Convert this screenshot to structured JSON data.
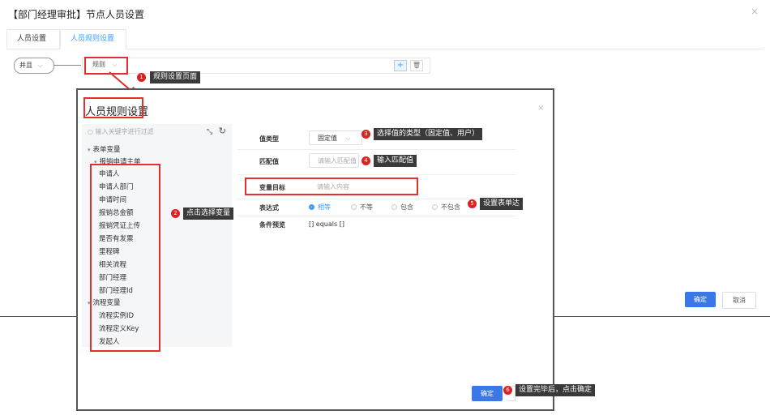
{
  "outer": {
    "title": "【部门经理审批】节点人员设置",
    "close": "×",
    "tabs": [
      {
        "label": "人员设置"
      },
      {
        "label": "人员规则设置"
      }
    ],
    "and_select": "并且",
    "rule_select": "规则",
    "add_button": "+",
    "delete_button": "🗑",
    "ok_button": "确定",
    "cancel_button": "取消"
  },
  "inner": {
    "title": "人员规则设置",
    "close": "×",
    "search_placeholder": "输入关键字进行过滤",
    "tree": {
      "form_vars": "表单变量",
      "main_form": "报销申请主单",
      "fields": [
        "申请人",
        "申请人部门",
        "申请时间",
        "报销总金额",
        "报销凭证上传",
        "是否有发票",
        "里程碑",
        "相关流程",
        "部门经理",
        "部门经理Id"
      ],
      "flow_vars": "流程变量",
      "flow_fields": [
        "流程实例ID",
        "流程定义Key",
        "发起人"
      ]
    },
    "form": {
      "value_type_label": "值类型",
      "value_type_value": "固定值",
      "match_label": "匹配值",
      "match_placeholder": "请输入匹配值",
      "target_label": "变量目标",
      "target_placeholder": "请输入内容",
      "expr_label": "表达式",
      "expr_options": [
        "相等",
        "不等",
        "包含",
        "不包含"
      ],
      "expr_selected": "相等",
      "preview_label": "条件预览",
      "preview_value": "[] equals []"
    },
    "ok_button": "确定"
  },
  "callouts": [
    {
      "num": "1",
      "text": "规则设置页面"
    },
    {
      "num": "2",
      "text": "点击选择变量"
    },
    {
      "num": "3",
      "text": "选择值的类型（固定值、用户）"
    },
    {
      "num": "4",
      "text": "输入匹配值"
    },
    {
      "num": "5",
      "text": "设置表单达"
    },
    {
      "num": "6",
      "text": "设置完毕后，点击确定"
    }
  ],
  "colors": {
    "accent": "#409eff",
    "annotation": "#e03030",
    "primary_button": "#3a78e7"
  }
}
